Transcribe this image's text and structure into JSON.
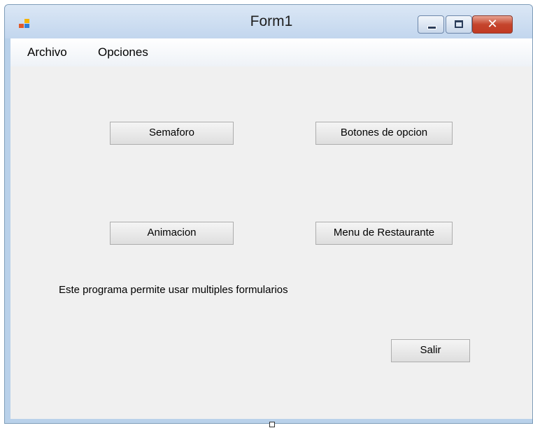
{
  "window": {
    "title": "Form1"
  },
  "menu": {
    "items": [
      "Archivo",
      "Opciones"
    ]
  },
  "buttons": {
    "semaforo": "Semaforo",
    "botones_opcion": "Botones de opcion",
    "animacion": "Animacion",
    "menu_restaurante": "Menu de Restaurante",
    "salir": "Salir"
  },
  "description": "Este programa  permite usar multiples formularios",
  "colors": {
    "close_button": "#c4442c",
    "client_bg": "#f0f0f0",
    "frame": "#b9d1ea"
  }
}
